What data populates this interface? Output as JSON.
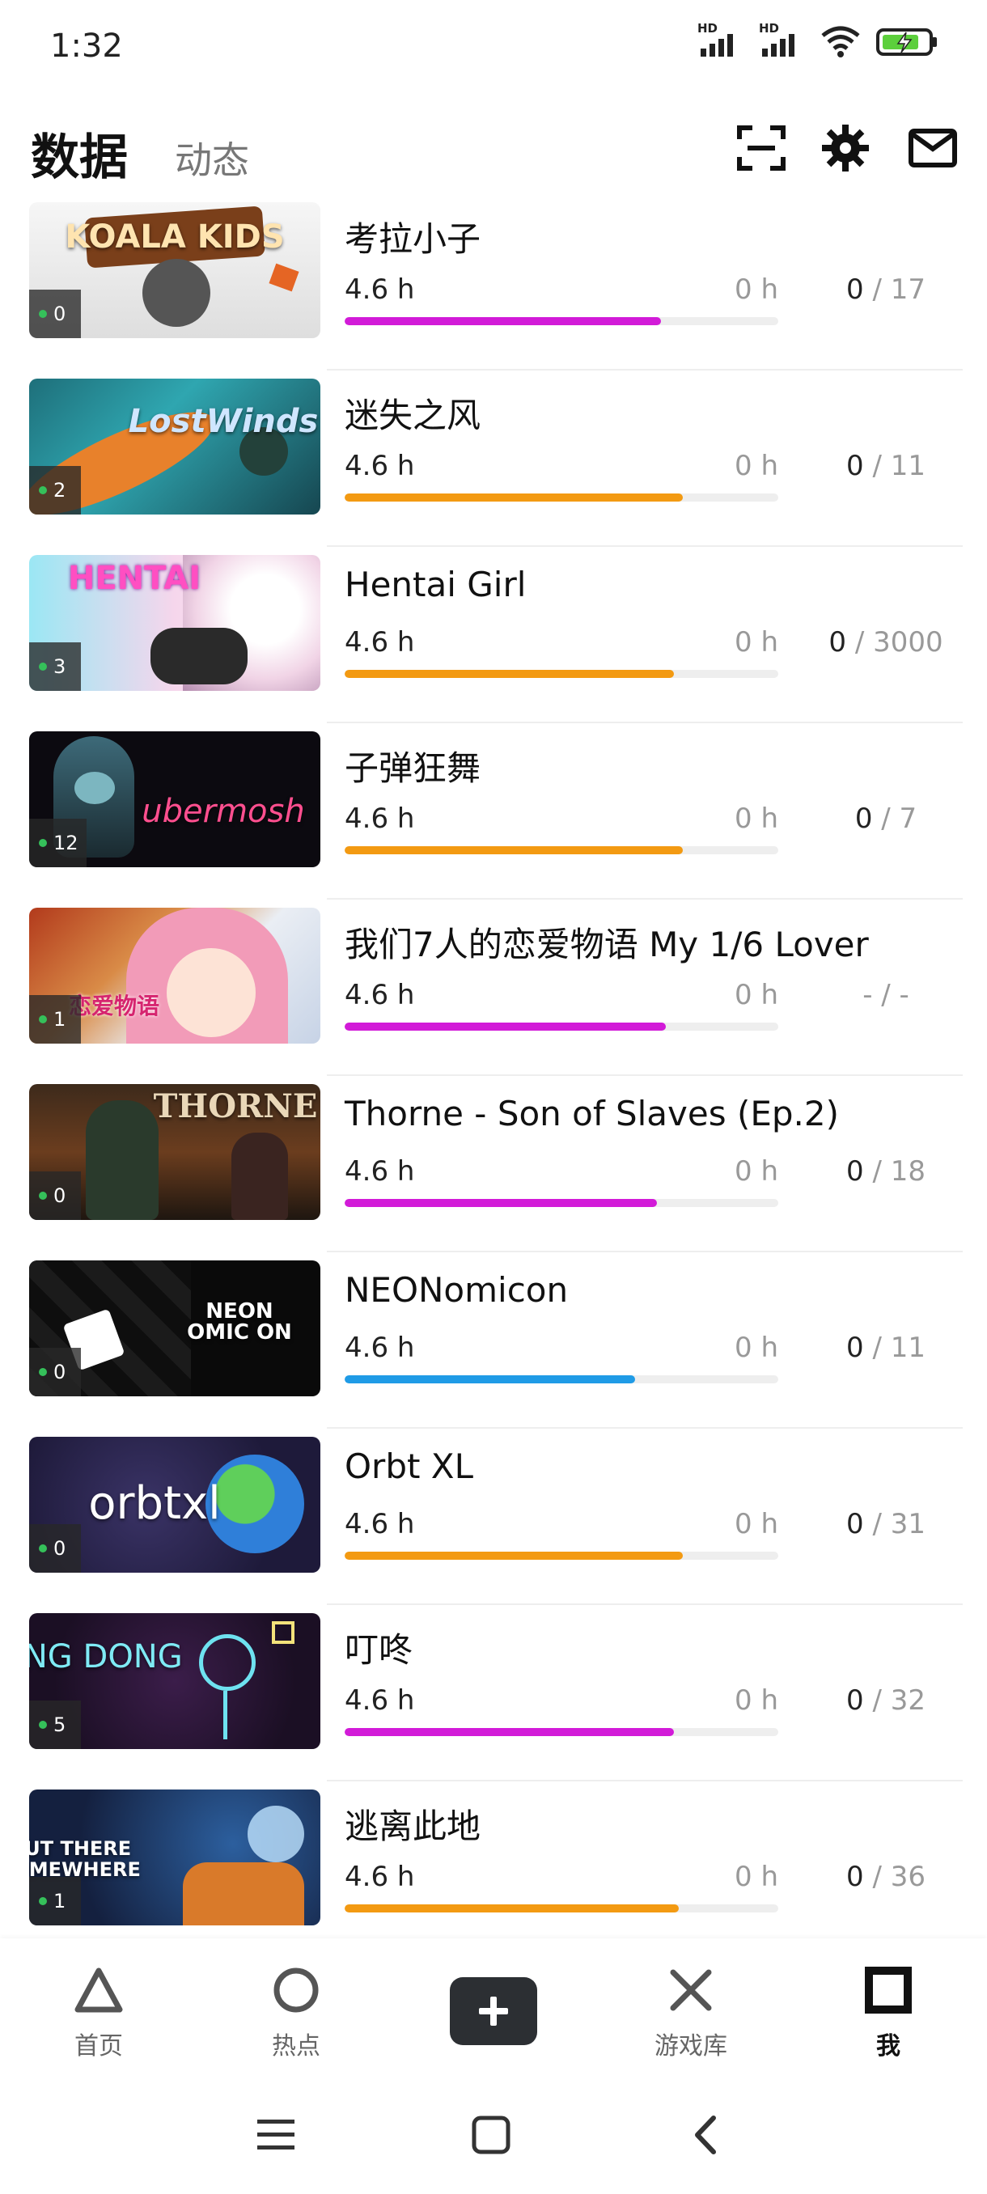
{
  "status": {
    "time": "1:32",
    "hd1": "HD",
    "hd2": "HD"
  },
  "header": {
    "tabs": [
      "数据",
      "动态"
    ],
    "icons": [
      "scan-icon",
      "settings-icon",
      "mail-icon"
    ]
  },
  "colors": {
    "magenta": "#d21bd8",
    "orange": "#f39a12",
    "blue": "#1f9be6",
    "badge_dot": "#35c05a"
  },
  "games": [
    {
      "title": "考拉小子",
      "badge": "0",
      "hours": "4.6 h",
      "recent": "0 h",
      "ach_done": "0",
      "ach_total": " / 17",
      "progress": 0.73,
      "color": "#d21bd8",
      "thumb_text": "KOALA KIDS"
    },
    {
      "title": "迷失之风",
      "badge": "2",
      "hours": "4.6 h",
      "recent": "0 h",
      "ach_done": "0",
      "ach_total": " / 11",
      "progress": 0.78,
      "color": "#f39a12",
      "thumb_text": "LostWinds"
    },
    {
      "title": "Hentai Girl",
      "badge": "3",
      "hours": "4.6 h",
      "recent": "0 h",
      "ach_done": "0",
      "ach_total": " / 3000",
      "progress": 0.76,
      "color": "#f39a12",
      "thumb_text": "HENTAI"
    },
    {
      "title": "子弹狂舞",
      "badge": "12",
      "hours": "4.6 h",
      "recent": "0 h",
      "ach_done": "0",
      "ach_total": " / 7",
      "progress": 0.78,
      "color": "#f39a12",
      "thumb_text": "ubermosh"
    },
    {
      "title": "我们7人的恋爱物语 My 1/6 Lover",
      "badge": "1",
      "hours": "4.6 h",
      "recent": "0 h",
      "ach_done": "",
      "ach_total": "- / -",
      "progress": 0.74,
      "color": "#d21bd8",
      "thumb_text": "恋爱物语"
    },
    {
      "title": "Thorne - Son of Slaves (Ep.2)",
      "badge": "0",
      "hours": "4.6 h",
      "recent": "0 h",
      "ach_done": "0",
      "ach_total": " / 18",
      "progress": 0.72,
      "color": "#d21bd8",
      "thumb_text": "THORNE"
    },
    {
      "title": "NEONomicon",
      "badge": "0",
      "hours": "4.6 h",
      "recent": "0 h",
      "ach_done": "0",
      "ach_total": " / 11",
      "progress": 0.67,
      "color": "#1f9be6",
      "thumb_text": "NEON OMIC ON"
    },
    {
      "title": "Orbt XL",
      "badge": "0",
      "hours": "4.6 h",
      "recent": "0 h",
      "ach_done": "0",
      "ach_total": " / 31",
      "progress": 0.78,
      "color": "#f39a12",
      "thumb_text": "orbtxl"
    },
    {
      "title": "叮咚",
      "badge": "5",
      "hours": "4.6 h",
      "recent": "0 h",
      "ach_done": "0",
      "ach_total": " / 32",
      "progress": 0.76,
      "color": "#d21bd8",
      "thumb_text": "DING DONG"
    },
    {
      "title": "逃离此地",
      "badge": "1",
      "hours": "4.6 h",
      "recent": "0 h",
      "ach_done": "0",
      "ach_total": " / 36",
      "progress": 0.77,
      "color": "#f39a12",
      "thumb_text": "OUT THERE SOMEWHERE"
    }
  ],
  "bottom_nav": [
    {
      "label": "首页",
      "icon": "triangle-icon"
    },
    {
      "label": "热点",
      "icon": "circle-icon"
    },
    {
      "label": "",
      "icon": "plus-icon"
    },
    {
      "label": "游戏库",
      "icon": "cross-icon"
    },
    {
      "label": "我",
      "icon": "square-icon"
    }
  ]
}
